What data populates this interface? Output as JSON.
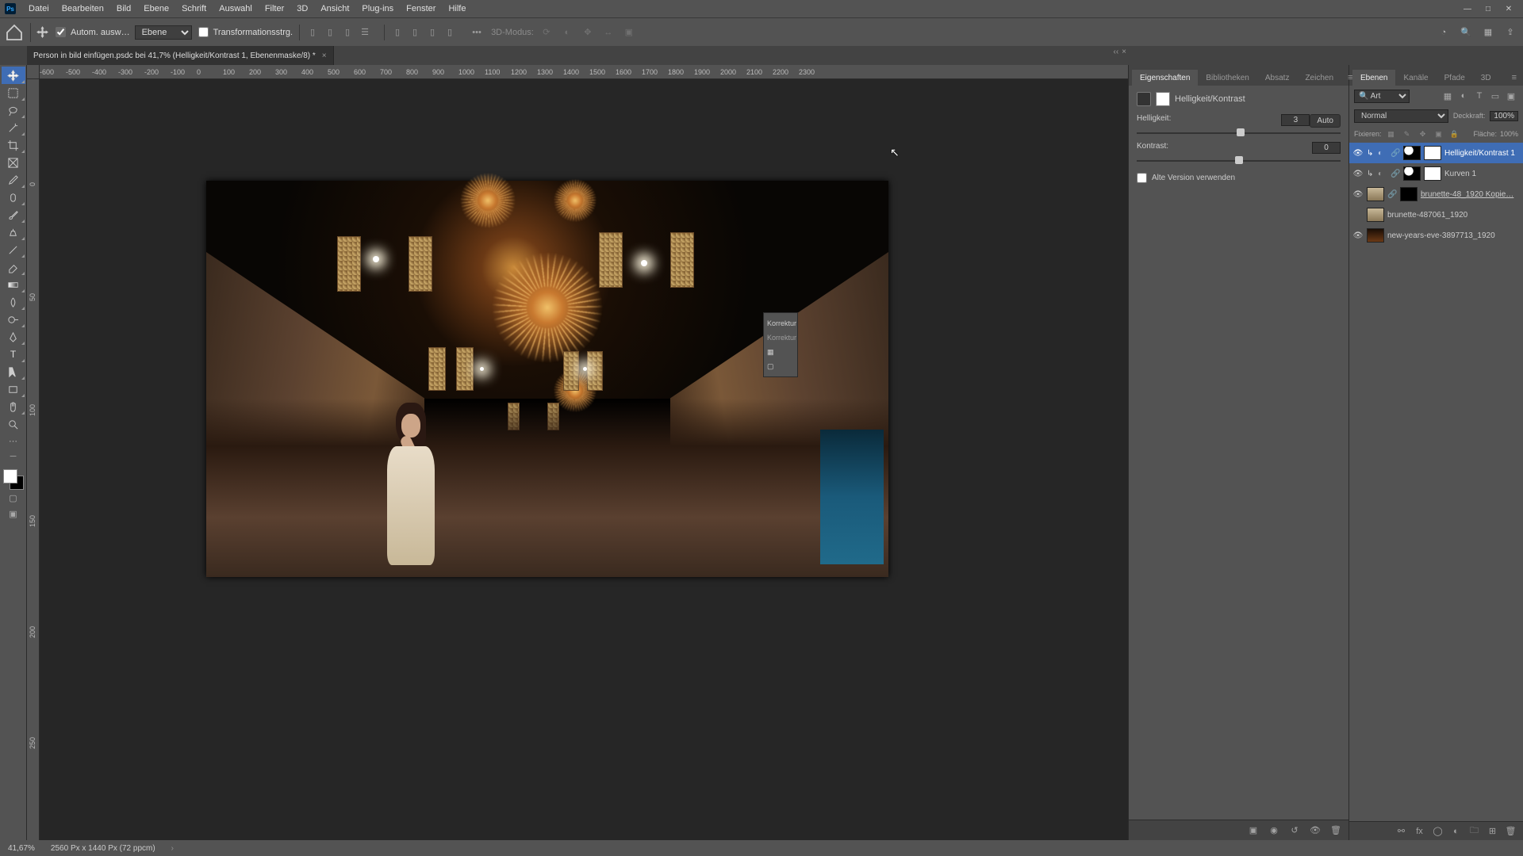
{
  "menu": {
    "items": [
      "Datei",
      "Bearbeiten",
      "Bild",
      "Ebene",
      "Schrift",
      "Auswahl",
      "Filter",
      "3D",
      "Ansicht",
      "Plug-ins",
      "Fenster",
      "Hilfe"
    ]
  },
  "optionsbar": {
    "auto_select_label": "Autom. ausw…",
    "target_dropdown": "Ebene",
    "transform_label": "Transformationsstrg.",
    "mode_3d_label": "3D-Modus:"
  },
  "document": {
    "tab_title": "Person in bild einfügen.psdc bei 41,7% (Helligkeit/Kontrast 1, Ebenenmaske/8) *"
  },
  "ruler_h": [
    "-600",
    "-500",
    "-400",
    "-300",
    "-200",
    "-100",
    "0",
    "100",
    "200",
    "300",
    "400",
    "500",
    "600",
    "700",
    "800",
    "900",
    "1000",
    "1100",
    "1200",
    "1300",
    "1400",
    "1500",
    "1600",
    "1700",
    "1800",
    "1900",
    "2000",
    "2100",
    "2200",
    "2300"
  ],
  "ruler_v": [
    "0",
    "50",
    "100",
    "150",
    "200",
    "250"
  ],
  "properties_panel": {
    "tabs": [
      "Eigenschaften",
      "Bibliotheken",
      "Absatz",
      "Zeichen"
    ],
    "adjustment_name": "Helligkeit/Kontrast",
    "auto_button": "Auto",
    "brightness_label": "Helligkeit:",
    "brightness_value": "3",
    "contrast_label": "Kontrast:",
    "contrast_value": "0",
    "legacy_label": "Alte Version verwenden"
  },
  "korrekturen": {
    "title": "Korrektur",
    "subtitle": "Korrektur"
  },
  "layers_panel": {
    "tabs": [
      "Ebenen",
      "Kanäle",
      "Pfade",
      "3D"
    ],
    "filter_kind": "Art",
    "blend_mode": "Normal",
    "opacity_label": "Deckkraft:",
    "opacity_value": "100%",
    "lock_label": "Fixieren:",
    "fill_label": "Fläche:",
    "fill_value": "100%",
    "layers": [
      {
        "name": "Helligkeit/Kontrast 1",
        "visible": true,
        "selected": true,
        "clip": true,
        "type": "adj",
        "mask": "white"
      },
      {
        "name": "Kurven 1",
        "visible": true,
        "selected": false,
        "clip": true,
        "type": "adj",
        "mask": "white"
      },
      {
        "name": "brunette-48_1920 Kopie…",
        "visible": true,
        "selected": false,
        "clip": false,
        "type": "img2",
        "mask": "black",
        "underline": true
      },
      {
        "name": "brunette-487061_1920",
        "visible": false,
        "selected": false,
        "clip": false,
        "type": "img2",
        "mask": null
      },
      {
        "name": "new-years-eve-3897713_1920",
        "visible": true,
        "selected": false,
        "clip": false,
        "type": "img3",
        "mask": null
      }
    ]
  },
  "statusbar": {
    "zoom": "41,67%",
    "doc_info": "2560 Px x 1440 Px (72 ppcm)"
  }
}
